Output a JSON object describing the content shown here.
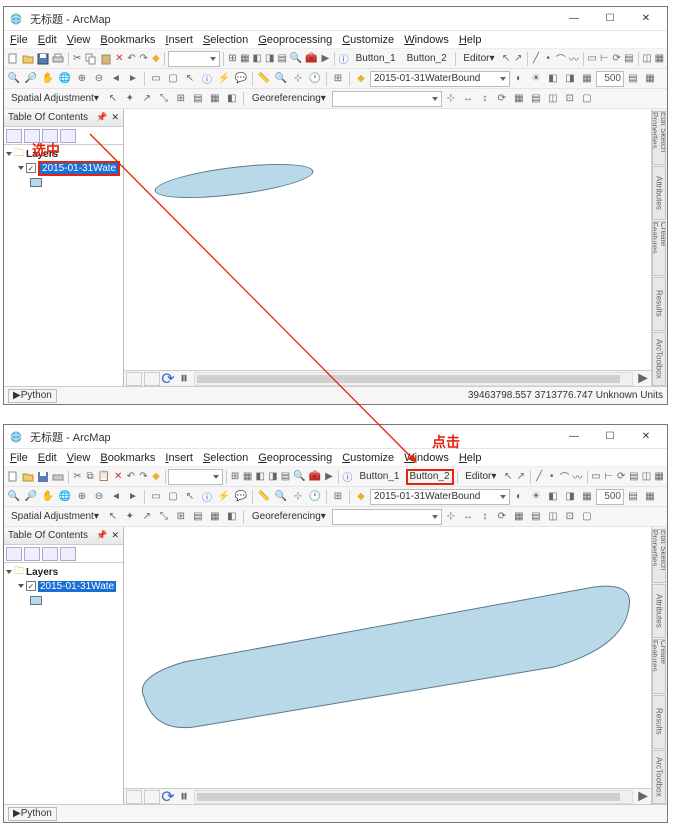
{
  "window": {
    "title": "无标题 - ArcMap"
  },
  "winbtns": {
    "min": "—",
    "max": "☐",
    "close": "✕"
  },
  "menu": {
    "file": "File",
    "edit": "Edit",
    "view": "View",
    "bookmarks": "Bookmarks",
    "insert": "Insert",
    "selection": "Selection",
    "geoprocessing": "Geoprocessing",
    "customize": "Customize",
    "windows": "Windows",
    "help": "Help"
  },
  "toolbar1": {
    "button1": "Button_1",
    "button2": "Button_2",
    "editor": "Editor",
    "editor_arrow": "▾",
    "layer_combo": "2015-01-31WaterBound",
    "scale_val": "500"
  },
  "toolbar3": {
    "spatial_adj": "Spatial Adjustment",
    "georef": "Georeferencing"
  },
  "toc": {
    "title": "Table Of Contents",
    "pin": "📌",
    "close": "✕",
    "root": "Layers",
    "layer_name": "2015-01-31Wate"
  },
  "rtabs": {
    "t1": "Edit Sketch Properties",
    "t2": "Attributes",
    "t3": "Create Features",
    "t4": "Results",
    "t5": "ArcToolbox"
  },
  "status": {
    "python": "Python",
    "coords": "39463798.557 3713776.747 Unknown Units"
  },
  "annotations": {
    "select_label": "选中",
    "click_label": "点击"
  }
}
